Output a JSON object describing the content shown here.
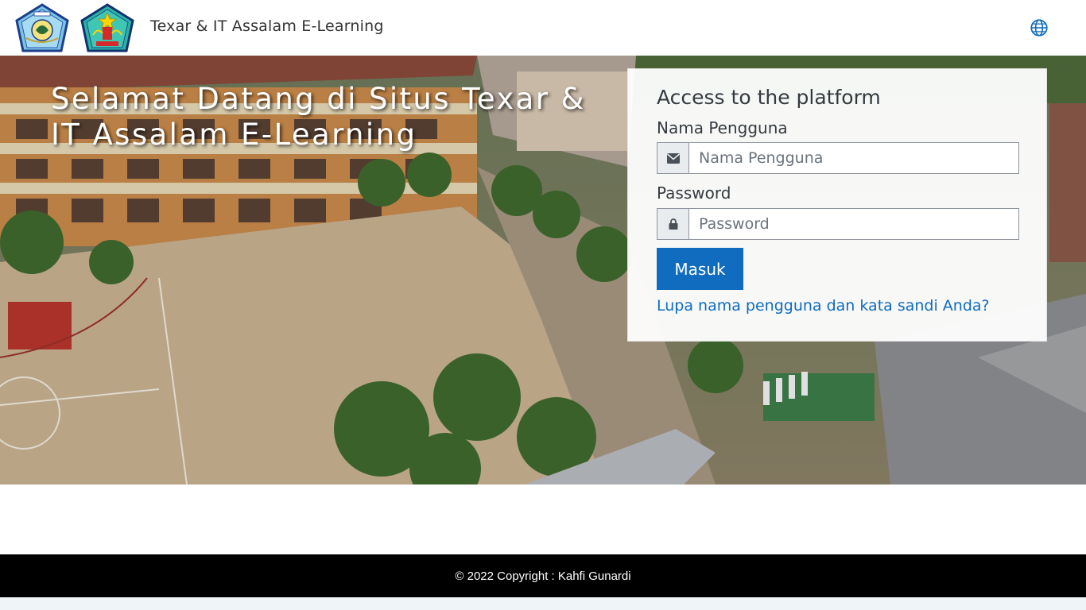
{
  "header": {
    "site_name": "Texar & IT Assalam E-Learning",
    "logo_left_icon": "school-emblem-logo",
    "logo_right_icon": "province-emblem-logo",
    "language_icon": "globe-icon"
  },
  "hero": {
    "title": "Selamat Datang di Situs Texar & IT Assalam E-Learning",
    "background": "aerial-school-campus-photo"
  },
  "login": {
    "title": "Access to the platform",
    "username_label": "Nama Pengguna",
    "username_placeholder": "Nama Pengguna",
    "username_icon": "envelope-icon",
    "password_label": "Password",
    "password_placeholder": "Password",
    "password_icon": "lock-icon",
    "submit_label": "Masuk",
    "forgot_link": "Lupa nama pengguna dan kata sandi Anda?"
  },
  "footer": {
    "copyright": "© 2022 Copyright : Kahfi Gunardi"
  },
  "colors": {
    "primary": "#0f6cbf",
    "footer_bg": "#000000",
    "header_bg": "#ffffff"
  }
}
